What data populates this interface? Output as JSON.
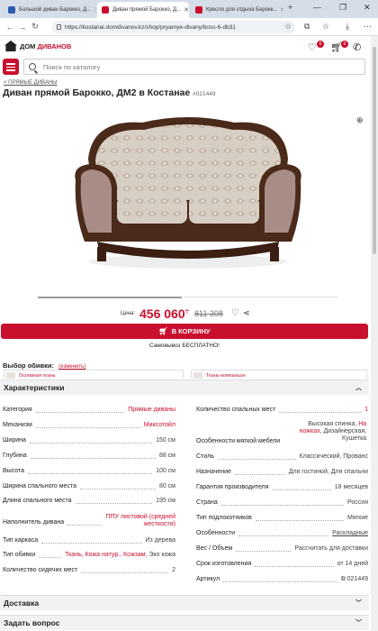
{
  "browser": {
    "tabs": [
      {
        "title": "Большой диван Барокко, Д..."
      },
      {
        "title": "Диван прямой Барокко, Д..."
      },
      {
        "title": "Кресло для отдыха Барокк..."
      }
    ],
    "url": "https://kostanai.domdivanov.kz/shop/pryamye-divany/boss-6-db31"
  },
  "site": {
    "logo_part1": "ДОМ",
    "logo_part2": "ДИВАНОВ",
    "favorites_count": "0",
    "cart_count": "0",
    "search_placeholder": "Поиск по каталогу"
  },
  "product": {
    "breadcrumb": "< ПРЯМЫЕ ДИВАНЫ",
    "title": "Диван прямой Барокко, ДМ2 в Костанае",
    "sku": "#021449",
    "price_label": "Цена:",
    "price": "456 060",
    "currency": "₸",
    "old_price": "811 308",
    "cart_button": "В КОРЗИНУ",
    "pickup": "Самовывоз БЕСПЛАТНО!",
    "upholstery_label": "Выбор обивки:",
    "upholstery_change": "(изменить)",
    "fabrics": [
      "Основная ткань",
      "Ткань-компаньон"
    ]
  },
  "sections": {
    "specs": "Характеристики",
    "delivery": "Доставка",
    "question": "Задать вопрос"
  },
  "specs_left": [
    {
      "k": "Категория",
      "v": "Прямые диваны"
    },
    {
      "k": "Механизм",
      "v": "Миксотойл"
    },
    {
      "k": "Ширина",
      "v": "150 см"
    },
    {
      "k": "Глубина",
      "v": "88 см"
    },
    {
      "k": "Высота",
      "v": "100 см"
    },
    {
      "k": "Ширина спального места",
      "v": "80 см"
    },
    {
      "k": "Длина спального места",
      "v": "195 см"
    },
    {
      "k": "Наполнитель дивана",
      "v": "ППУ листовой (средней жесткости)"
    },
    {
      "k": "Тип каркаса",
      "v": "Из дерева"
    },
    {
      "k": "Тип обивки",
      "v_red": "Ткань, Кожа натур., Кожзам,",
      "v_rest": " Эко кожа"
    },
    {
      "k": "Количество сидячих мест",
      "v": "2"
    }
  ],
  "specs_right": [
    {
      "k": "Количество спальных мест",
      "v": "1"
    },
    {
      "k": "Особенности мягкой мебели",
      "v_a": "Высокая спинка, ",
      "v_red": "На ножках",
      "v_b": ", Дизайнерская, Кушетка"
    },
    {
      "k": "Стиль",
      "v": "Классический, Прованс"
    },
    {
      "k": "Назначение",
      "v": "Для гостиной, Для спальни"
    },
    {
      "k": "Гарантия производителя",
      "v": "18 месяцев"
    },
    {
      "k": "Страна",
      "v": "Россия"
    },
    {
      "k": "Тип подлокотников",
      "v": "Мягкие"
    },
    {
      "k": "Особенности",
      "v": "Раскладные"
    },
    {
      "k": "Вес / Объем",
      "v": "Рассчитать для доставки"
    },
    {
      "k": "Срок изготовления",
      "v": "от 14 дней"
    },
    {
      "k": "Артикул",
      "v": "021449"
    }
  ],
  "colors": {
    "accent": "#c8102e"
  }
}
